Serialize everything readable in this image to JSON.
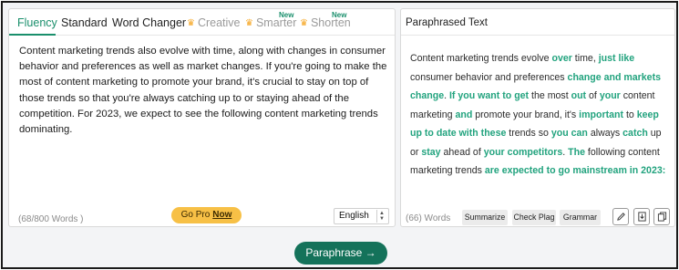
{
  "tabs": {
    "fluency": "Fluency",
    "standard": "Standard",
    "word_changer": "Word Changer",
    "creative": "Creative",
    "smarter": "Smarter",
    "shorten": "Shorten",
    "new_badge": "New"
  },
  "input": {
    "text": "Content marketing trends also evolve with time, along with changes in consumer behavior and preferences as well as market changes. If you're going to make the most of content marketing to promote your brand, it's crucial to stay on top of those trends so that you're always catching up to or staying ahead of the competition. For 2023, we expect to see the following content marketing trends dominating.",
    "word_count": "(68/800 Words )",
    "go_pro": "Go Pro",
    "go_pro_now": "Now",
    "language": "English"
  },
  "output": {
    "title": "Paraphrased Text",
    "word_count": "(66) Words",
    "summarize": "Summarize",
    "check_plag": "Check Plag",
    "grammar": "Grammar",
    "segments": [
      {
        "t": "Content marketing trends evolve ",
        "h": false
      },
      {
        "t": "over",
        "h": true
      },
      {
        "t": " time, ",
        "h": false
      },
      {
        "t": "just like",
        "h": true
      },
      {
        "t": " consumer behavior and preferences ",
        "h": false
      },
      {
        "t": "change and markets change",
        "h": true
      },
      {
        "t": ". ",
        "h": false
      },
      {
        "t": "If you want to get",
        "h": true
      },
      {
        "t": " the most ",
        "h": false
      },
      {
        "t": "out",
        "h": true
      },
      {
        "t": " of ",
        "h": false
      },
      {
        "t": "your",
        "h": true
      },
      {
        "t": " content marketing ",
        "h": false
      },
      {
        "t": "and",
        "h": true
      },
      {
        "t": " promote your brand, it's ",
        "h": false
      },
      {
        "t": "important",
        "h": true
      },
      {
        "t": " to ",
        "h": false
      },
      {
        "t": "keep up to date with these",
        "h": true
      },
      {
        "t": " trends so ",
        "h": false
      },
      {
        "t": "you can",
        "h": true
      },
      {
        "t": " always ",
        "h": false
      },
      {
        "t": "catch",
        "h": true
      },
      {
        "t": " up or ",
        "h": false
      },
      {
        "t": "stay",
        "h": true
      },
      {
        "t": " ahead of ",
        "h": false
      },
      {
        "t": "your competitors",
        "h": true
      },
      {
        "t": ". ",
        "h": false
      },
      {
        "t": "The",
        "h": true
      },
      {
        "t": " following content marketing trends ",
        "h": false
      },
      {
        "t": "are expected to go mainstream in 2023:",
        "h": true
      }
    ]
  },
  "paraphrase_button": "Paraphrase →",
  "colors": {
    "accent": "#1a8f6c",
    "highlight": "#22a37e",
    "button": "#14725a",
    "go_pro": "#f7c046",
    "crown": "#f5a623"
  },
  "icons": [
    "crown-icon",
    "pen-icon",
    "download-icon",
    "copy-icon",
    "chevron-updown-icon"
  ]
}
